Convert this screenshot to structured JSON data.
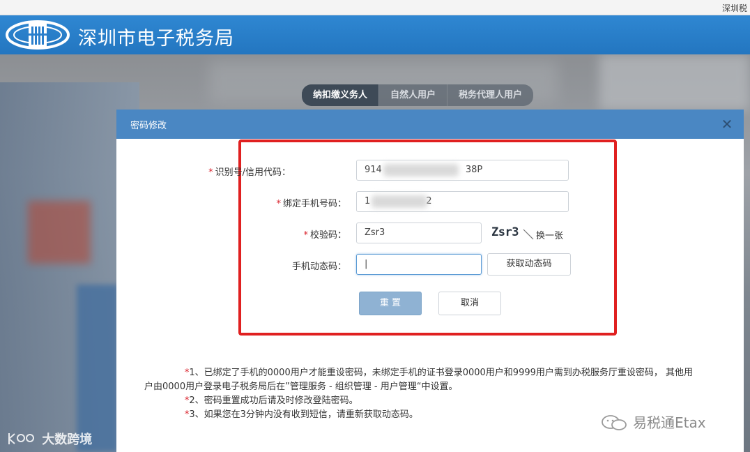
{
  "top_bar": {
    "corner_text": "深圳税"
  },
  "header": {
    "site_title": "深圳市电子税务局",
    "accent_color": "#2a7fcc"
  },
  "user_tabs": [
    {
      "label": "纳扣缴义务人",
      "active": true
    },
    {
      "label": "自然人用户",
      "active": false
    },
    {
      "label": "税务代理人用户",
      "active": false
    }
  ],
  "modal": {
    "title": "密码修改",
    "close_icon": "close-icon",
    "form": {
      "tax_id": {
        "label": "识别号/信用代码：",
        "required": "*",
        "value_prefix": "914",
        "value_suffix": "38P"
      },
      "phone": {
        "label": "绑定手机号码：",
        "required": "*",
        "value_prefix": "1",
        "value_suffix": "2"
      },
      "captcha": {
        "label": "校验码：",
        "required": "*",
        "value": "Zsr3",
        "image_text": "Zsr3",
        "refresh_label": "换一张"
      },
      "sms_code": {
        "label": "手机动态码：",
        "value": "|",
        "get_code_label": "获取动态码"
      },
      "reset_label": "重 置",
      "cancel_label": "取消"
    },
    "notes": {
      "bullet": "*",
      "note1_line1": "1、已绑定了手机的0000用户才能重设密码，未绑定手机的证书登录0000用户和9999用户需到办税服务厅重设密码， 其他用",
      "note1_line2": "户由0000用户登录电子税务局后在”管理服务 - 组织管理 - 用户管理“中设置。",
      "note2": "2、密码重置成功后请及时修改登陆密码。",
      "note3": "3、如果您在3分钟内没有收到短信，请重新获取动态码。"
    }
  },
  "watermarks": {
    "left": "大数跨境",
    "right": "易税通Etax"
  },
  "colors": {
    "required": "#d9232d",
    "primary_button": "#8fb2d3",
    "modal_header": "#4a87c3",
    "highlight_border": "#e02020"
  }
}
